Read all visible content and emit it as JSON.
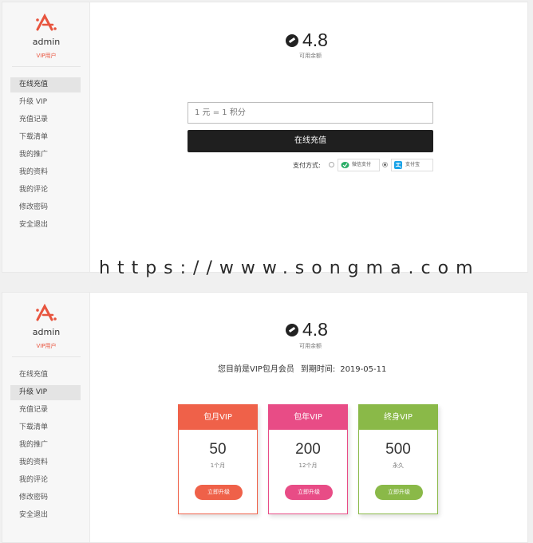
{
  "user": {
    "name": "admin",
    "tag": "VIP用户"
  },
  "nav": [
    "在线充值",
    "升级 VIP",
    "充值记录",
    "下载清单",
    "我的推广",
    "我的资料",
    "我的评论",
    "修改密码",
    "安全退出"
  ],
  "balance": {
    "value": "4.8",
    "label": "可用余额"
  },
  "recharge": {
    "placeholder": "1 元 = 1 积分",
    "button": "在线充值",
    "method_label": "支付方式:",
    "methods": [
      {
        "name": "微信支付",
        "icon": "wechat-pay-icon",
        "selected": false
      },
      {
        "name": "支付宝",
        "icon": "alipay-icon",
        "selected": true
      }
    ]
  },
  "vip_status": {
    "text": "您目前是VIP包月会员",
    "expire_label": "到期时间:",
    "expire_date": "2019-05-11"
  },
  "plans": [
    {
      "title": "包月VIP",
      "price": "50",
      "period": "1个月",
      "button": "立即升级",
      "color": "#ef6149"
    },
    {
      "title": "包年VIP",
      "price": "200",
      "period": "12个月",
      "button": "立即升级",
      "color": "#e84c86"
    },
    {
      "title": "终身VIP",
      "price": "500",
      "period": "永久",
      "button": "立即升级",
      "color": "#8ab948"
    }
  ],
  "watermark": "https://www.songma.com",
  "colors": {
    "accent": "#e8553f",
    "dark_button": "#1f1f1f"
  }
}
